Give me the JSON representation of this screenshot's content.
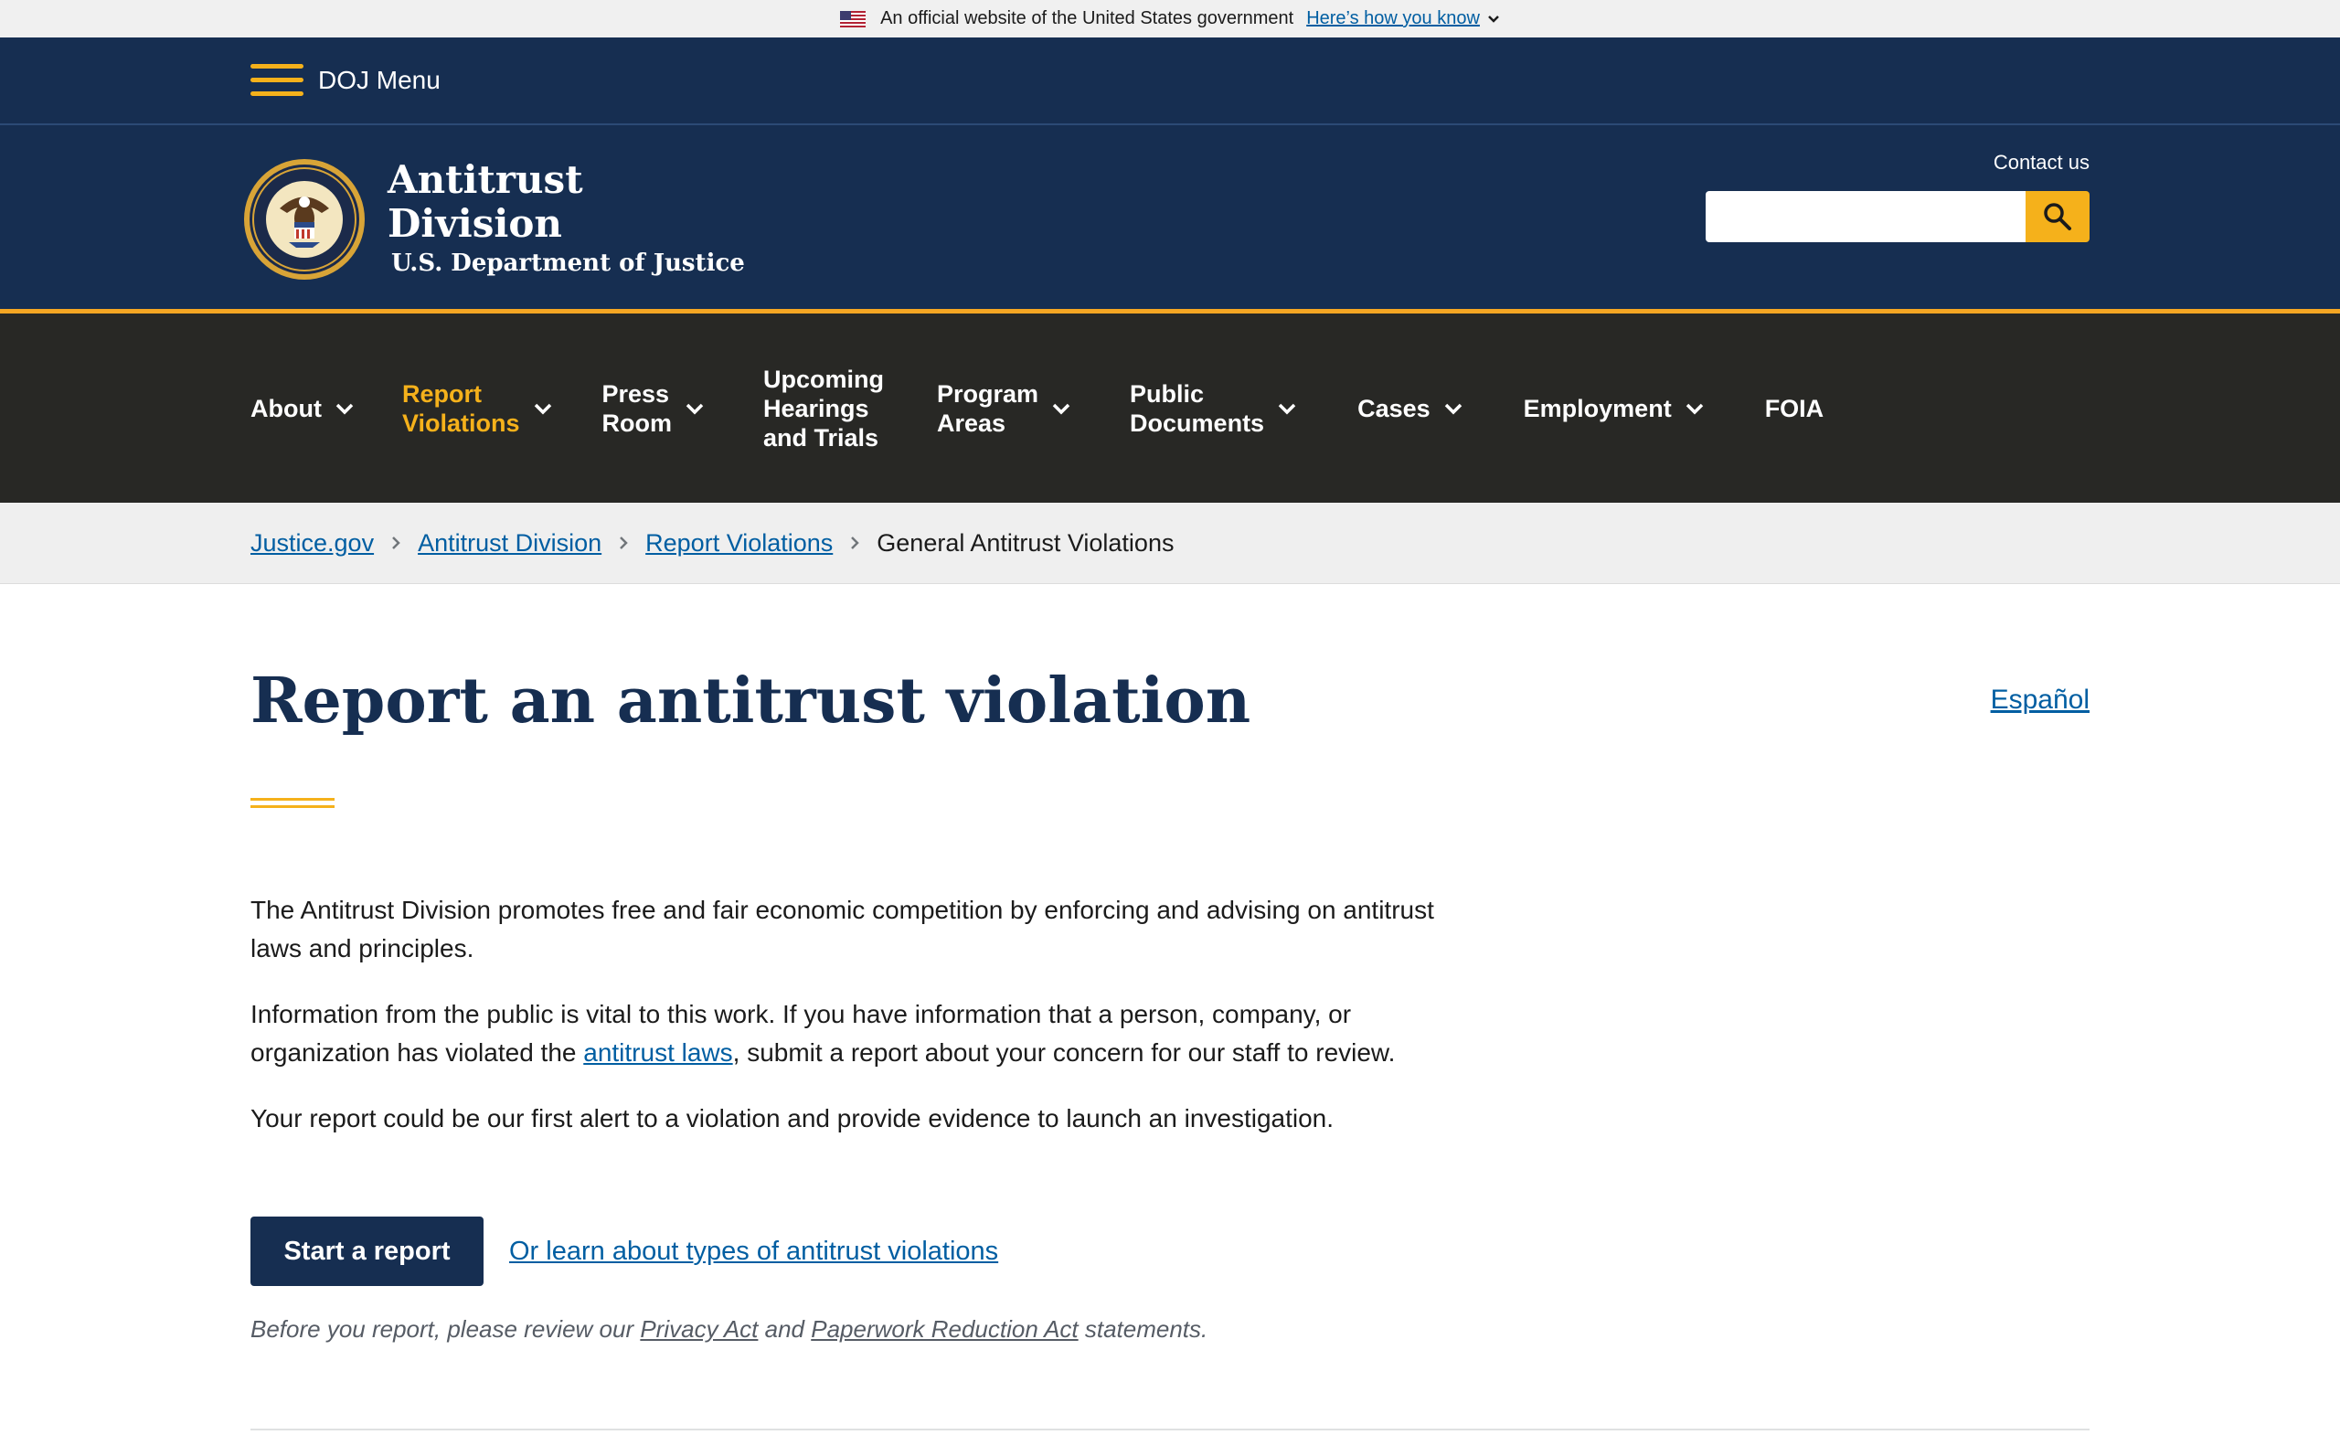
{
  "gov_banner": {
    "text": "An official website of the United States government",
    "how_link": "Here’s how you know"
  },
  "doj_menu": {
    "label": "DOJ Menu"
  },
  "header": {
    "title_line1": "Antitrust",
    "title_line2": "Division",
    "subtitle": "U.S. Department of Justice",
    "contact": "Contact us",
    "search_value": "",
    "accent_color": "#f5b11b",
    "brand_color": "#162e51"
  },
  "nav": {
    "items": [
      {
        "label": "About",
        "has_dropdown": true
      },
      {
        "label": "Report\nViolations",
        "has_dropdown": true,
        "active": true
      },
      {
        "label": "Press\nRoom",
        "has_dropdown": true
      },
      {
        "label": "Upcoming\nHearings\nand Trials",
        "has_dropdown": false
      },
      {
        "label": "Program\nAreas",
        "has_dropdown": true
      },
      {
        "label": "Public\nDocuments",
        "has_dropdown": true
      },
      {
        "label": "Cases",
        "has_dropdown": true
      },
      {
        "label": "Employment",
        "has_dropdown": true
      },
      {
        "label": "FOIA",
        "has_dropdown": false
      }
    ]
  },
  "breadcrumb": {
    "items": [
      "Justice.gov",
      "Antitrust Division",
      "Report Violations"
    ],
    "current": "General Antitrust Violations"
  },
  "main": {
    "title": "Report an antitrust violation",
    "language_link": "Español",
    "p1": "The Antitrust Division promotes free and fair economic competition by enforcing and advising on antitrust laws and principles.",
    "p2_before": "Information from the public is vital to this work. If you have information that a person, company, or organization has violated the ",
    "p2_link": "antitrust laws",
    "p2_after": ", submit a report about your concern for our staff to review.",
    "p3": "Your report could be our first alert to a violation and provide evidence to launch an investigation.",
    "start_button": "Start a report",
    "learn_link": "Or learn about types of antitrust violations",
    "note_before": "Before you report, please review our ",
    "note_link1": "Privacy Act",
    "note_mid": " and ",
    "note_link2": "Paperwork Reduction Act",
    "note_after": " statements."
  }
}
